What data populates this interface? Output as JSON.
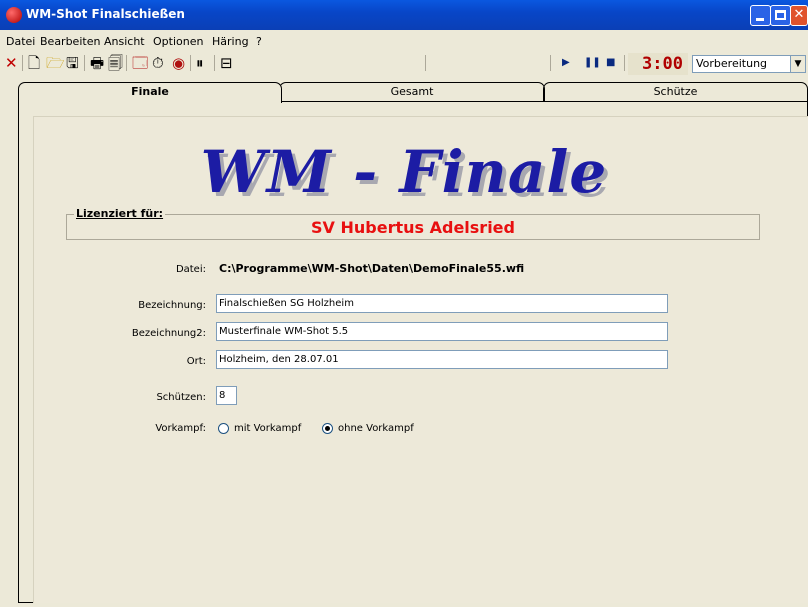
{
  "window": {
    "title": "WM-Shot Finalschießen"
  },
  "menu": [
    "Datei",
    "Bearbeiten",
    "Ansicht",
    "Optionen",
    "Häring",
    "?"
  ],
  "toolbar": {
    "icons": [
      "close-icon",
      "new-doc-icon",
      "open-folder-icon",
      "save-icon",
      "print-icon",
      "print-preview-icon",
      "display-icon",
      "stopwatch-icon",
      "target-icon",
      "shooter-icon",
      "list-icon"
    ],
    "timer": "3:00",
    "mode_value": "Vorbereitung"
  },
  "tabs": [
    {
      "label": "Finale",
      "active": true
    },
    {
      "label": "Gesamt",
      "active": false
    },
    {
      "label": "Schütze",
      "active": false
    }
  ],
  "main": {
    "headline": "WM - Finale",
    "license_label": "Lizenziert für:",
    "license_holder": "SV Hubertus Adelsried",
    "file_label": "Datei:",
    "file_path": "C:\\Programme\\WM-Shot\\Daten\\DemoFinale55.wfi",
    "bezeichnung_label": "Bezeichnung:",
    "bezeichnung_value": "Finalschießen SG Holzheim",
    "bezeichnung2_label": "Bezeichnung2:",
    "bezeichnung2_value": "Musterfinale WM-Shot 5.5",
    "ort_label": "Ort:",
    "ort_value": "Holzheim, den 28.07.01",
    "schuetzen_label": "Schützen:",
    "schuetzen_value": "8",
    "vorkampf_label": "Vorkampf:",
    "vorkampf_options": [
      "mit Vorkampf",
      "ohne Vorkampf"
    ],
    "vorkampf_selected": "ohne Vorkampf"
  },
  "colors": {
    "titlebar": "#0a58e0",
    "headline": "#1c1ca4",
    "license": "#e81010",
    "timer": "#b00000"
  }
}
